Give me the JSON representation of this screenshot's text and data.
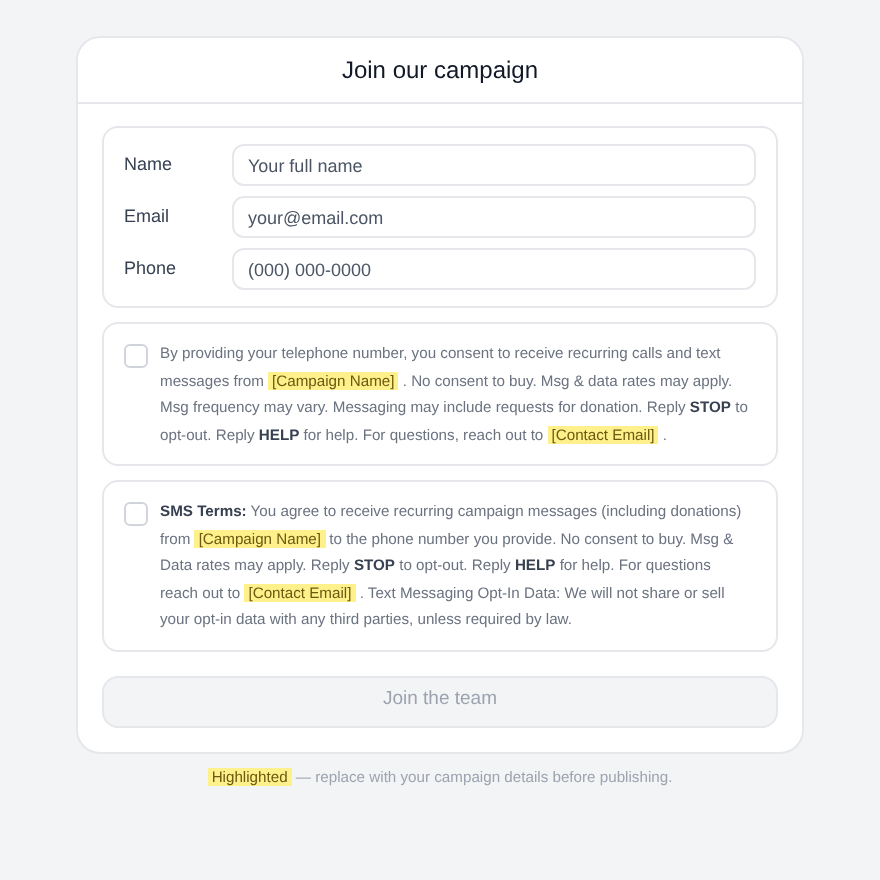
{
  "title": "Join our campaign",
  "fields": [
    {
      "label": "Name",
      "placeholder": "Your full name"
    },
    {
      "label": "Email",
      "placeholder": "your@email.com"
    },
    {
      "label": "Phone",
      "placeholder": "(000) 000-0000"
    }
  ],
  "consents": [
    {
      "checked": false,
      "segments": [
        {
          "kind": "text",
          "text": "By providing your telephone number, you consent to receive recurring calls and text messages from "
        },
        {
          "kind": "highlight",
          "text": "[Campaign Name]"
        },
        {
          "kind": "text",
          "text": " . No consent to buy. Msg & data rates may apply. Msg frequency may vary. Messaging may include requests for donation. Reply "
        },
        {
          "kind": "bold",
          "text": "STOP"
        },
        {
          "kind": "text",
          "text": " to opt-out. Reply "
        },
        {
          "kind": "bold",
          "text": "HELP"
        },
        {
          "kind": "text",
          "text": " for help. For questions, reach out to "
        },
        {
          "kind": "highlight",
          "text": "[Contact Email]"
        },
        {
          "kind": "text",
          "text": " ."
        }
      ]
    },
    {
      "checked": false,
      "segments": [
        {
          "kind": "bold",
          "text": "SMS Terms:"
        },
        {
          "kind": "text",
          "text": " You agree to receive recurring campaign messages (including donations) from "
        },
        {
          "kind": "highlight",
          "text": "[Campaign Name]"
        },
        {
          "kind": "text",
          "text": " to the phone number you provide. No consent to buy. Msg & Data rates may apply. Reply "
        },
        {
          "kind": "bold",
          "text": "STOP"
        },
        {
          "kind": "text",
          "text": " to opt-out. Reply "
        },
        {
          "kind": "bold",
          "text": "HELP"
        },
        {
          "kind": "text",
          "text": " for help. For questions reach out to "
        },
        {
          "kind": "highlight",
          "text": "[Contact Email]"
        },
        {
          "kind": "text",
          "text": " . Text Messaging Opt-In Data: We will not share or sell your opt-in data with any third parties, unless required by law."
        }
      ]
    }
  ],
  "submit": {
    "label": "Join the team",
    "disabled": true
  },
  "footnote": {
    "segments": [
      {
        "kind": "highlight",
        "text": "Highlighted"
      },
      {
        "kind": "text",
        "text": " — replace with your campaign details before publishing."
      }
    ]
  }
}
